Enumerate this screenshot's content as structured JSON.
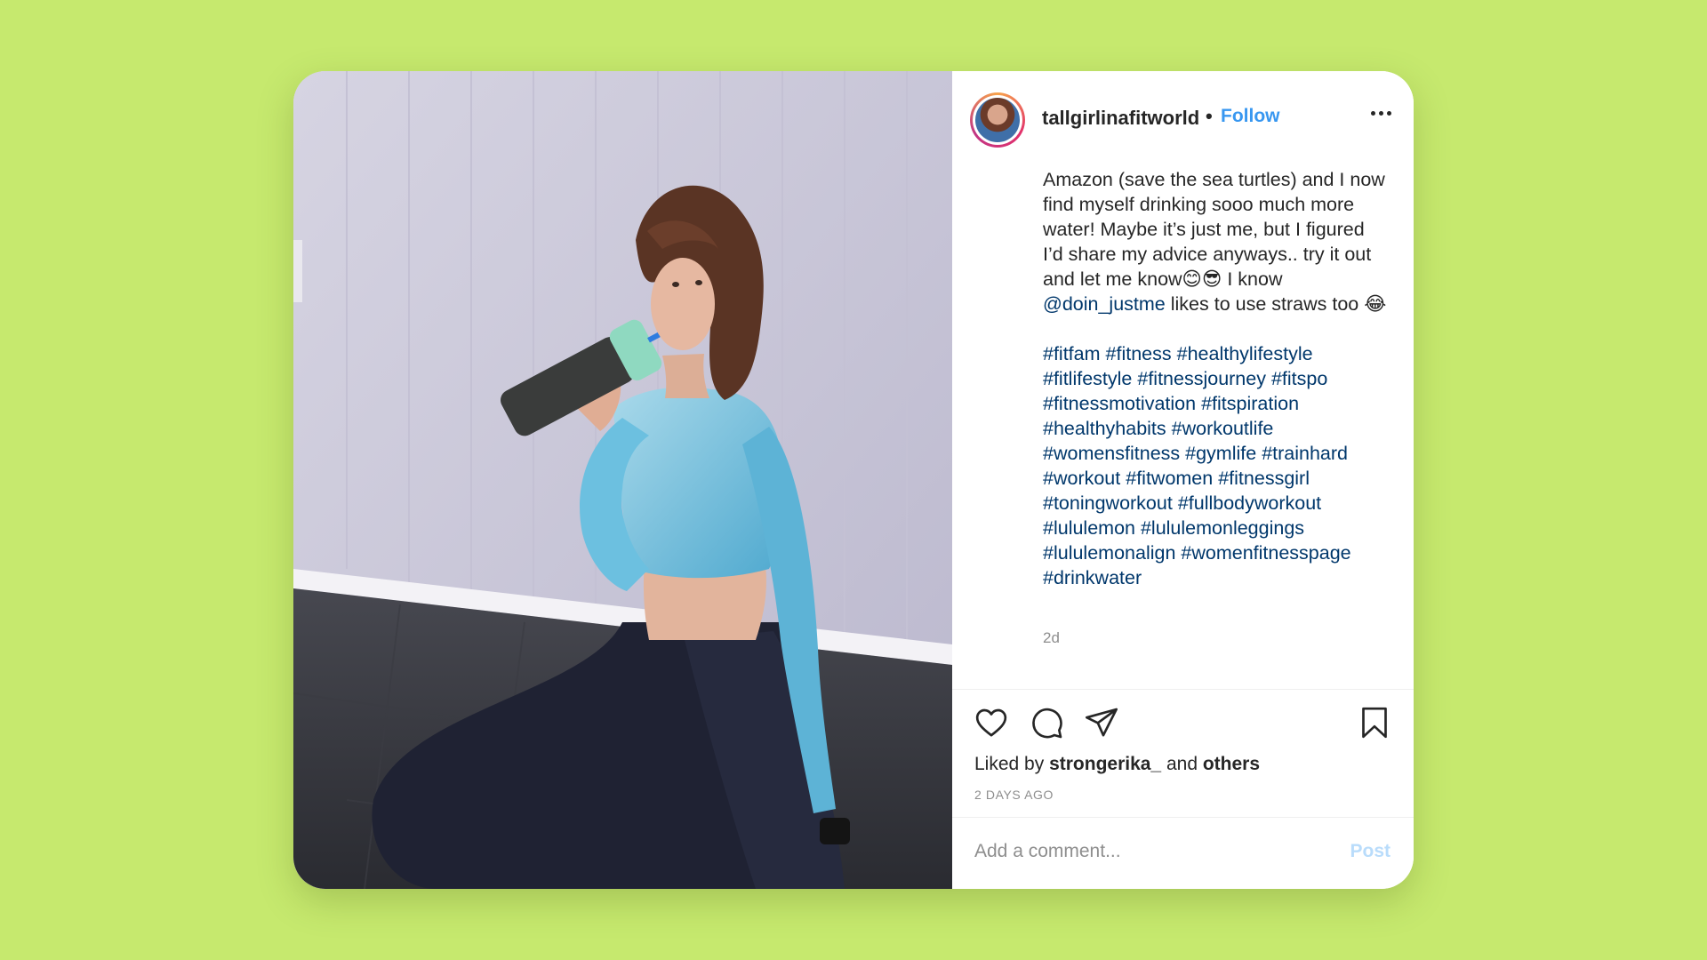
{
  "post": {
    "username": "tallgirlinafitworld",
    "separator": "•",
    "follow_label": "Follow",
    "more_icon": "more-options-icon",
    "caption_intro": "Amazon (save the sea turtles) and I now find myself drinking sooo much more water! Maybe it’s just me, but I figured I’d share my advice anyways.. try it out and let me know😊😎 I know",
    "caption_mention": "@doin_justme",
    "caption_outro": " likes to use straws too 😂",
    "hashtags": [
      "#fitfam",
      "#fitness",
      "#healthylifestyle",
      "#fitlifestyle",
      "#fitnessjourney",
      "#fitspo",
      "#fitnessmotivation",
      "#fitspiration",
      "#healthyhabits",
      "#workoutlife",
      "#womensfitness",
      "#gymlife",
      "#trainhard",
      "#workout",
      "#fitwomen",
      "#fitnessgirl",
      "#toningworkout",
      "#fullbodyworkout",
      "#lululemon",
      "#lululemonleggings",
      "#lululemonalign",
      "#womenfitnesspage",
      "#drinkwater"
    ],
    "caption_time": "2d"
  },
  "actions": {
    "icons": [
      "heart-icon",
      "comment-icon",
      "share-icon",
      "bookmark-icon"
    ]
  },
  "likes": {
    "prefix": "Liked by ",
    "user": "strongerika_",
    "middle": " and ",
    "others": "others"
  },
  "timestamp": "2 DAYS AGO",
  "comment": {
    "placeholder": "Add a comment...",
    "post_label": "Post"
  },
  "colors": {
    "background": "#c6e96e",
    "link": "#3897f0",
    "hashtag": "#00376b",
    "post_disabled": "#b9dcfb"
  }
}
